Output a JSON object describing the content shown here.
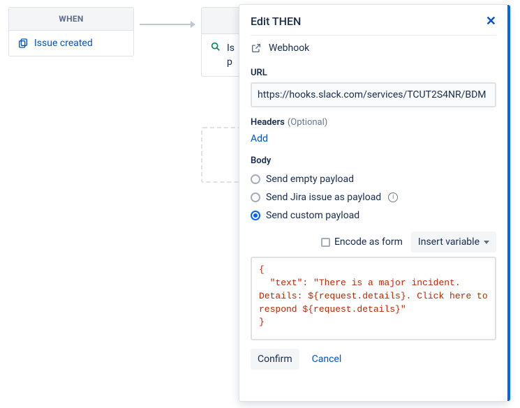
{
  "when": {
    "header": "WHEN",
    "row_label": "Issue created"
  },
  "then": {
    "body_line1": "Is",
    "body_line2": "p"
  },
  "panel": {
    "title": "Edit THEN",
    "subtype": "Webhook",
    "url_label": "URL",
    "url_value": "https://hooks.slack.com/services/TCUT2S4NR/BDM",
    "headers_label": "Headers",
    "optional_text": "(Optional)",
    "add_link": "Add",
    "body_label": "Body",
    "radio_empty": "Send empty payload",
    "radio_jira": "Send Jira issue as payload",
    "radio_custom": "Send custom payload",
    "encode_label": "Encode as form",
    "insert_var": "Insert variable",
    "payload_code": "{\n  \"text\": \"There is a major incident. Details: ${request.details}. Click here to respond ${request.details}\"\n}",
    "confirm": "Confirm",
    "cancel": "Cancel"
  }
}
